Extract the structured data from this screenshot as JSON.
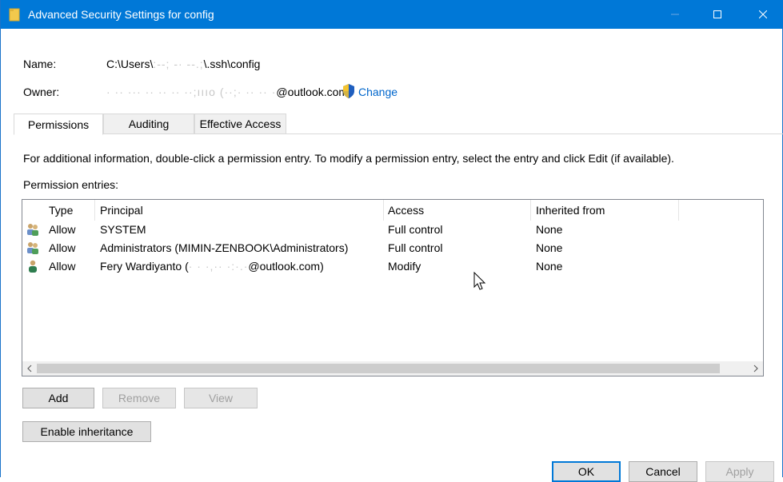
{
  "window": {
    "title": "Advanced Security Settings for config"
  },
  "info": {
    "name_label": "Name:",
    "name_value": "C:\\Users\\",
    "name_value_redacted": ":--; -· --.;",
    "name_value_tail": "\\.ssh\\config",
    "owner_label": "Owner:",
    "owner_redacted": "· ·· ··· ·· ·· ·· ··;ıııo (··;",
    "owner_redacted2": "· ·· ·· ·",
    "owner_tail": "@outlook.com)",
    "change_link": "Change"
  },
  "tabs": [
    {
      "label": "Permissions",
      "active": true
    },
    {
      "label": "Auditing",
      "active": false
    },
    {
      "label": "Effective Access",
      "active": false
    }
  ],
  "instructions": "For additional information, double-click a permission entry. To modify a permission entry, select the entry and click Edit (if available).",
  "entries_label": "Permission entries:",
  "table": {
    "columns": [
      "Type",
      "Principal",
      "Access",
      "Inherited from"
    ],
    "rows": [
      {
        "icon": "group-users-icon",
        "type": "Allow",
        "principal": "SYSTEM",
        "access": "Full control",
        "inherited": "None"
      },
      {
        "icon": "group-users-icon",
        "type": "Allow",
        "principal": "Administrators (MIMIN-ZENBOOK\\Administrators)",
        "access": "Full control",
        "inherited": "None"
      },
      {
        "icon": "user-icon",
        "type": "Allow",
        "principal": "Fery Wardiyanto (",
        "principal_redacted": "· · ·,·· ·:·.·",
        "principal_tail": "@outlook.com)",
        "access": "Modify",
        "inherited": "None"
      }
    ]
  },
  "buttons": {
    "add": "Add",
    "remove": "Remove",
    "view": "View",
    "enable_inheritance": "Enable inheritance",
    "ok": "OK",
    "cancel": "Cancel",
    "apply": "Apply"
  },
  "colors": {
    "titlebar": "#0078d7",
    "link": "#0066cc"
  }
}
